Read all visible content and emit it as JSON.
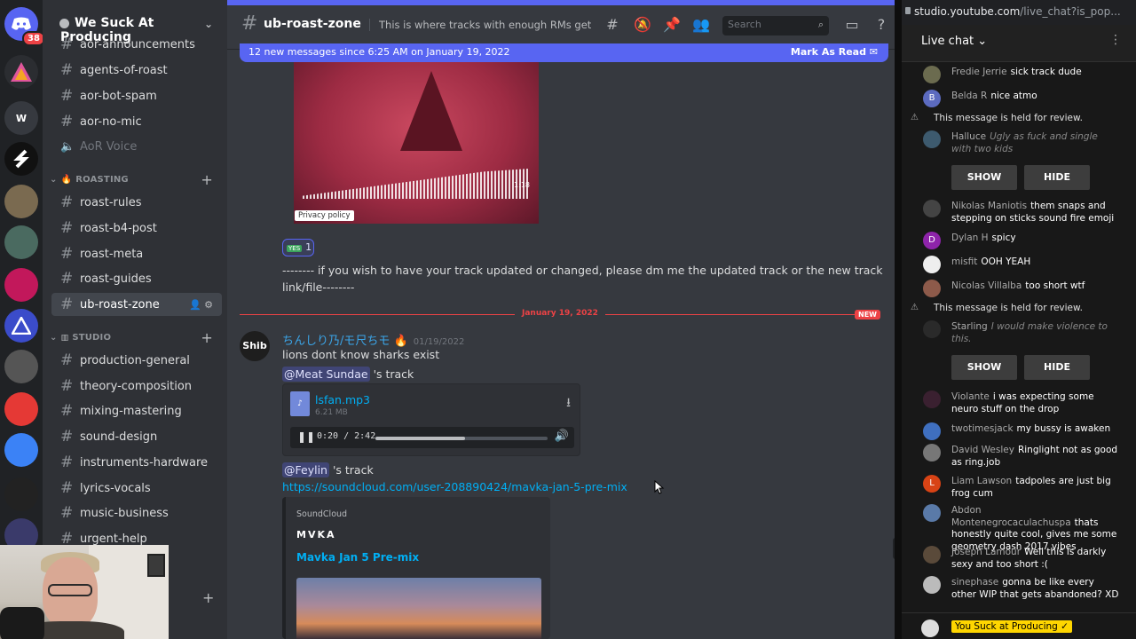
{
  "discord": {
    "server_name": "We Suck At Producing",
    "rail_badge": "38",
    "rail_letter": "W",
    "channels_top": [
      {
        "label": "aor-announcements"
      },
      {
        "label": "agents-of-roast"
      },
      {
        "label": "aor-bot-spam"
      },
      {
        "label": "aor-no-mic"
      }
    ],
    "voice_channel": "AoR Voice",
    "category_roasting": "ROASTING",
    "roasting_channels": [
      {
        "label": "roast-rules"
      },
      {
        "label": "roast-b4-post"
      },
      {
        "label": "roast-meta"
      },
      {
        "label": "roast-guides"
      },
      {
        "label": "ub-roast-zone"
      }
    ],
    "category_studio": "STUDIO",
    "studio_channels": [
      {
        "label": "production-general"
      },
      {
        "label": "theory-composition"
      },
      {
        "label": "mixing-mastering"
      },
      {
        "label": "sound-design"
      },
      {
        "label": "instruments-hardware"
      },
      {
        "label": "lyrics-vocals"
      },
      {
        "label": "music-business"
      },
      {
        "label": "urgent-help"
      }
    ],
    "header": {
      "channel": "ub-roast-zone",
      "topic": "This is where tracks with enough RMs get reposte...",
      "search_placeholder": "Search"
    },
    "new_messages_bar": {
      "text": "12 new messages since 6:25 AM on January 19, 2022",
      "action": "Mark As Read"
    },
    "embed_privacy": "Privacy policy",
    "embed_duration": "1:18",
    "reaction": {
      "emoji": "YES",
      "count": "1"
    },
    "pinned_text_line1": "-------- if you wish to have your track updated or changed, please dm me the updated track or the new track",
    "pinned_text_line2": "link/file--------",
    "divider_date": "January 19, 2022",
    "divider_new": "NEW",
    "message": {
      "avatar_text": "Shib",
      "author": "ちんしり乃/モ尺ちモ",
      "timestamp": "01/19/2022",
      "line1": "lions dont know sharks exist",
      "mention1": "@Meat Sundae",
      "mention1_suffix": "'s track",
      "file_name": "lsfan.mp3",
      "file_size": "6.21 MB",
      "player_time": "0:20 / 2:42",
      "progress": 0.52,
      "mention2": "@Feylin",
      "mention2_suffix": "'s track",
      "link": "https://soundcloud.com/user-208890424/mavka-jan-5-pre-mix",
      "sc_provider": "SoundCloud",
      "sc_author": "MVKA",
      "sc_title": "Mavka Jan 5 Pre-mix"
    }
  },
  "youtube": {
    "url_host": "studio.youtube.com",
    "url_path": "/live_chat?is_pop...",
    "chat_title": "Live chat",
    "held_text": "This message is held for review.",
    "show_label": "SHOW",
    "hide_label": "HIDE",
    "messages": [
      {
        "name": "Fredie Jerrie",
        "text": "sick track dude",
        "initial": "",
        "color": "#6b6b4f"
      },
      {
        "name": "Belda R",
        "text": "nice atmo",
        "initial": "B",
        "color": "#5c6bc0"
      },
      {
        "name": "Halluce",
        "text": "Ugly as fuck and single with two kids",
        "initial": "",
        "color": "#3d5a6e"
      },
      {
        "name": "Nikolas Maniotis",
        "text": "them snaps and stepping on sticks sound fire emoji",
        "initial": "",
        "color": "#444"
      },
      {
        "name": "Dylan H",
        "text": "spicy",
        "initial": "D",
        "color": "#8e24aa"
      },
      {
        "name": "misfit",
        "text": "OOH YEAH",
        "initial": "",
        "color": "#eeeeee"
      },
      {
        "name": "Nicolas Villalba",
        "text": "too short wtf",
        "initial": "",
        "color": "#8d5a4a"
      },
      {
        "name": "Starling",
        "text": "I would make violence to this.",
        "initial": "",
        "color": "#2a2a2a"
      },
      {
        "name": "Violante",
        "text": "i was expecting some neuro stuff on the drop",
        "initial": "",
        "color": "#3a2030"
      },
      {
        "name": "twotimesjack",
        "text": "my bussy is awaken",
        "initial": "",
        "color": "#3f6fbf"
      },
      {
        "name": "David Wesley",
        "text": "Ringlight not as good as ring.job",
        "initial": "",
        "color": "#777"
      },
      {
        "name": "Liam Lawson",
        "text": "tadpoles are just big frog cum",
        "initial": "L",
        "color": "#d84315"
      },
      {
        "name": "Abdon Montenegrocaculachuspa",
        "text": "thats honestly quite cool, gives me some geometry dash 2017 vibes",
        "initial": "",
        "color": "#5a7aa8"
      },
      {
        "name": "Joseph Lamour",
        "text": "Well this is darkly sexy and too short :(",
        "initial": "",
        "color": "#5a4a3a"
      },
      {
        "name": "sinephase",
        "text": "gonna be like every other WIP that gets abandoned? XD",
        "initial": "",
        "color": "#bbb"
      }
    ],
    "footer_channel": "You Suck at Producing ✓"
  }
}
